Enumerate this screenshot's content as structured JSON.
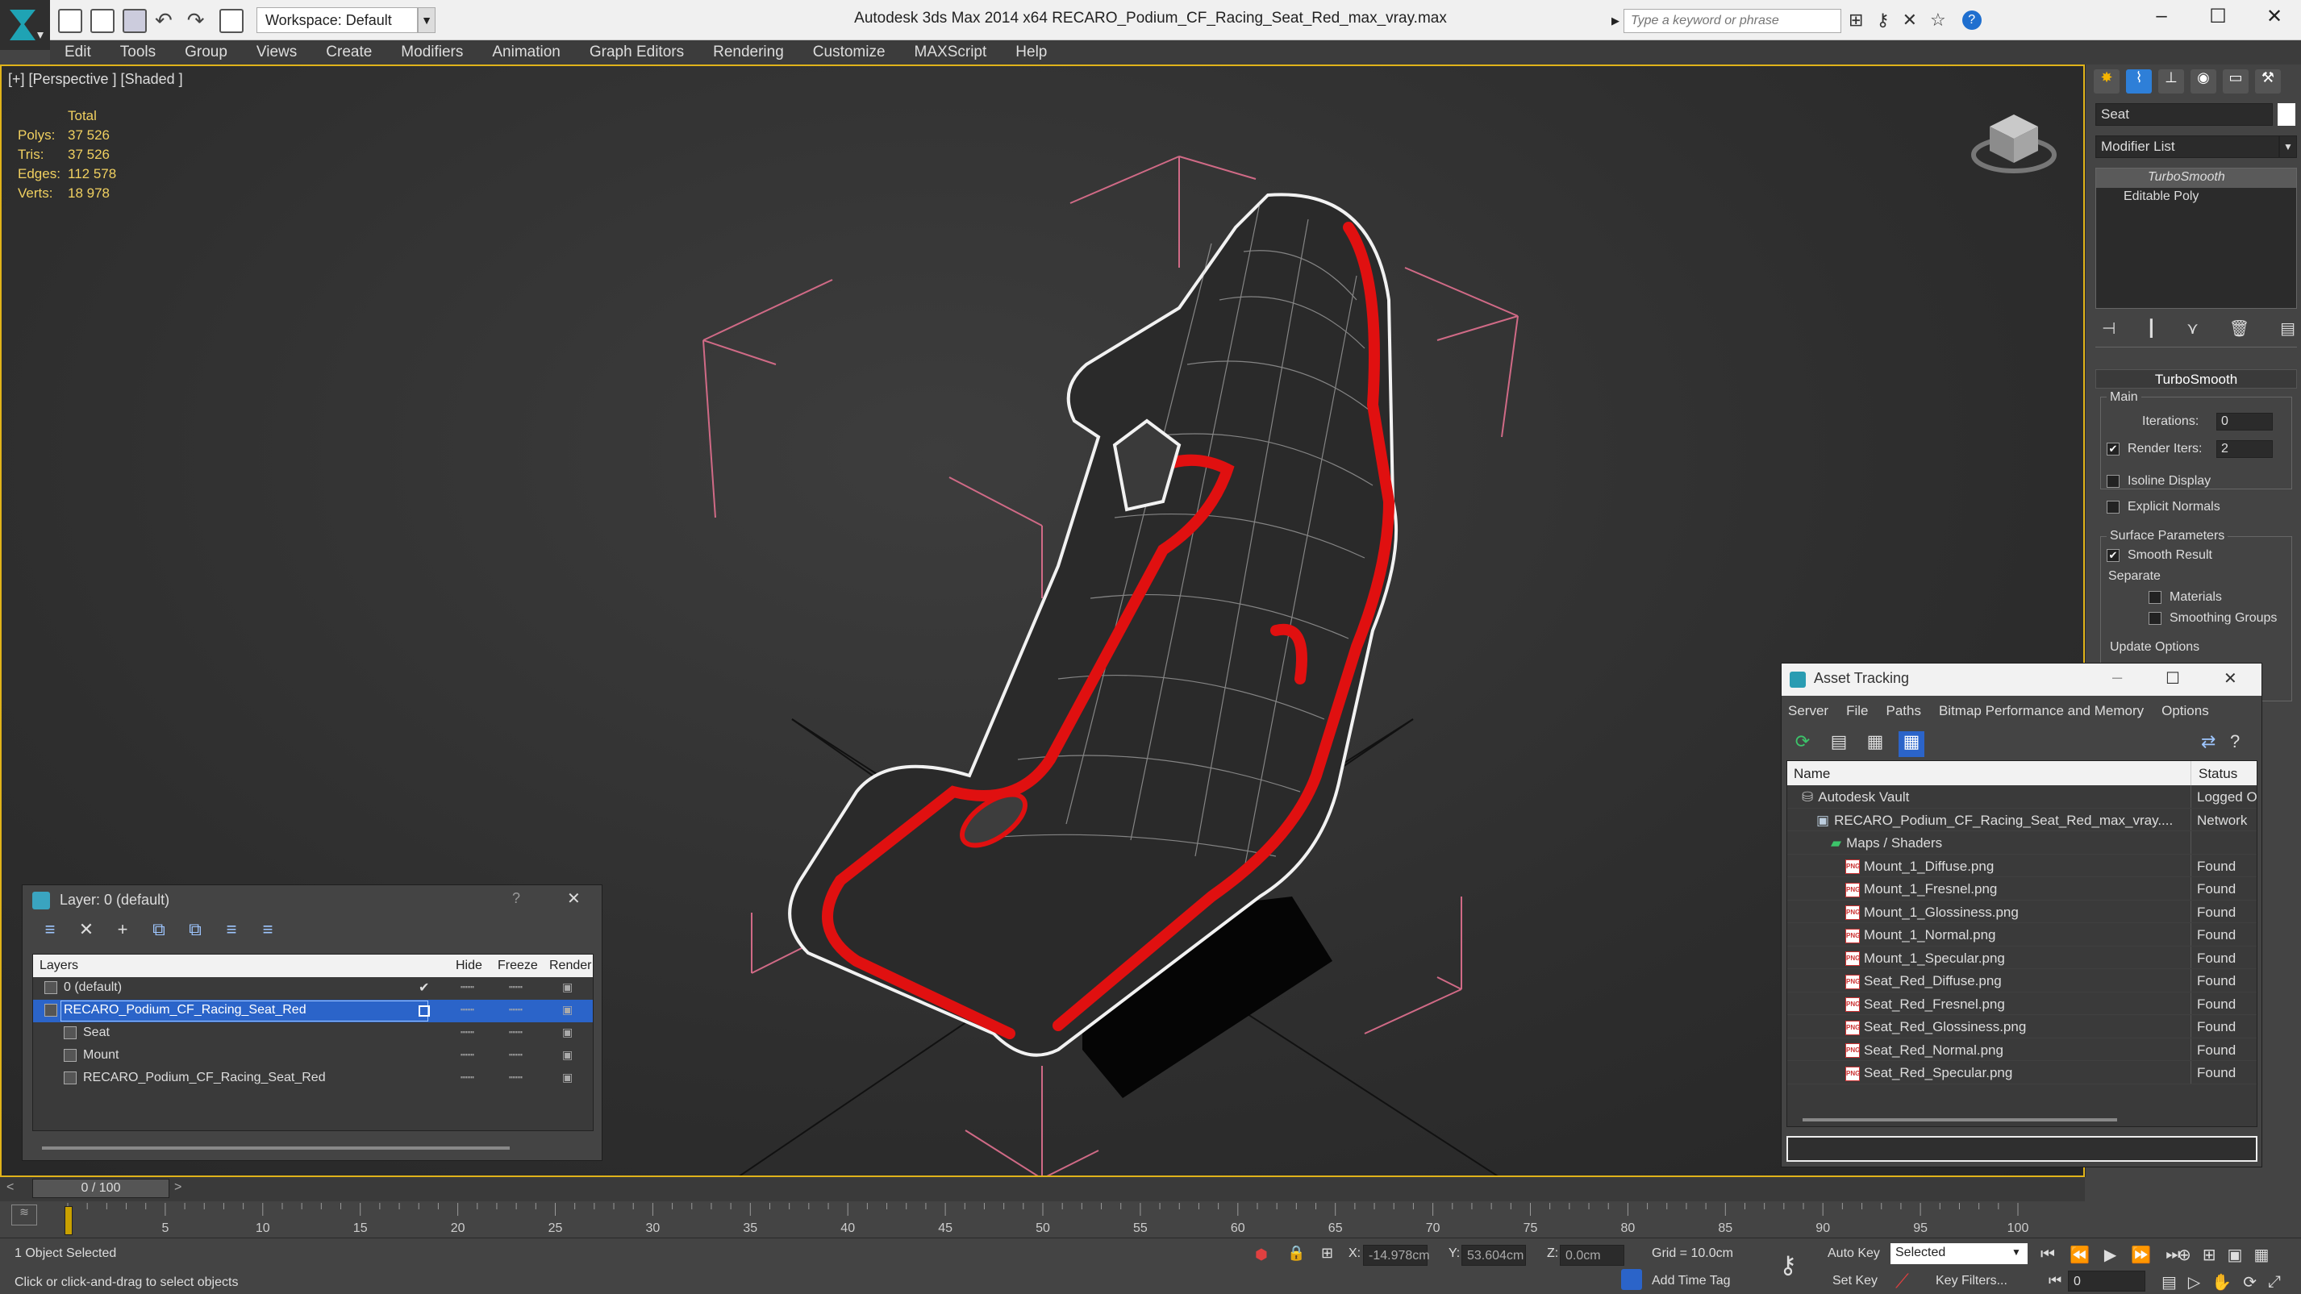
{
  "titlebar": {
    "title": "Autodesk 3ds Max  2014 x64     RECARO_Podium_CF_Racing_Seat_Red_max_vray.max",
    "workspace": "Workspace: Default",
    "search_placeholder": "Type a keyword or phrase"
  },
  "menu": [
    "Edit",
    "Tools",
    "Group",
    "Views",
    "Create",
    "Modifiers",
    "Animation",
    "Graph Editors",
    "Rendering",
    "Customize",
    "MAXScript",
    "Help"
  ],
  "viewport": {
    "label": "[+] [Perspective ] [Shaded ]",
    "stats_header": "Total",
    "stats": [
      {
        "k": "Polys:",
        "v": "37 526"
      },
      {
        "k": "Tris:",
        "v": "37 526"
      },
      {
        "k": "Edges:",
        "v": "112 578"
      },
      {
        "k": "Verts:",
        "v": "18 978"
      }
    ]
  },
  "command_panel": {
    "object_name": "Seat",
    "modifier_list": "Modifier List",
    "stack": [
      "TurboSmooth",
      "Editable Poly"
    ],
    "turbosmooth": {
      "title": "TurboSmooth",
      "main": "Main",
      "iterations_label": "Iterations:",
      "iterations": "0",
      "render_iters_label": "Render Iters:",
      "render_iters": "2",
      "isoline": "Isoline Display",
      "explicit": "Explicit Normals",
      "surface_params": "Surface Parameters",
      "smooth_result": "Smooth Result",
      "separate": "Separate",
      "materials": "Materials",
      "smoothing_groups": "Smoothing Groups",
      "update_options": "Update Options"
    }
  },
  "layer_dialog": {
    "title": "Layer: 0 (default)",
    "help": "?",
    "close": "✕",
    "columns": [
      "Layers",
      "Hide",
      "Freeze",
      "Render"
    ],
    "rows": [
      {
        "name": "0 (default)",
        "indent": 0,
        "selected": false,
        "check": "✔"
      },
      {
        "name": "RECARO_Podium_CF_Racing_Seat_Red",
        "indent": 0,
        "selected": true,
        "check": ""
      },
      {
        "name": "Seat",
        "indent": 1,
        "selected": false,
        "check": ""
      },
      {
        "name": "Mount",
        "indent": 1,
        "selected": false,
        "check": ""
      },
      {
        "name": "RECARO_Podium_CF_Racing_Seat_Red",
        "indent": 1,
        "selected": false,
        "check": ""
      }
    ]
  },
  "asset_tracking": {
    "title": "Asset Tracking",
    "menu": [
      "Server",
      "File",
      "Paths",
      "Bitmap Performance and Memory",
      "Options"
    ],
    "columns": [
      "Name",
      "Status"
    ],
    "rows": [
      {
        "name": "Autodesk Vault",
        "status": "Logged O",
        "indent": 1,
        "icon": "vault"
      },
      {
        "name": "RECARO_Podium_CF_Racing_Seat_Red_max_vray....",
        "status": "Network",
        "indent": 2,
        "icon": "max"
      },
      {
        "name": "Maps / Shaders",
        "status": "",
        "indent": 3,
        "icon": "folder"
      },
      {
        "name": "Mount_1_Diffuse.png",
        "status": "Found",
        "indent": 4,
        "icon": "png"
      },
      {
        "name": "Mount_1_Fresnel.png",
        "status": "Found",
        "indent": 4,
        "icon": "png"
      },
      {
        "name": "Mount_1_Glossiness.png",
        "status": "Found",
        "indent": 4,
        "icon": "png"
      },
      {
        "name": "Mount_1_Normal.png",
        "status": "Found",
        "indent": 4,
        "icon": "png"
      },
      {
        "name": "Mount_1_Specular.png",
        "status": "Found",
        "indent": 4,
        "icon": "png"
      },
      {
        "name": "Seat_Red_Diffuse.png",
        "status": "Found",
        "indent": 4,
        "icon": "png"
      },
      {
        "name": "Seat_Red_Fresnel.png",
        "status": "Found",
        "indent": 4,
        "icon": "png"
      },
      {
        "name": "Seat_Red_Glossiness.png",
        "status": "Found",
        "indent": 4,
        "icon": "png"
      },
      {
        "name": "Seat_Red_Normal.png",
        "status": "Found",
        "indent": 4,
        "icon": "png"
      },
      {
        "name": "Seat_Red_Specular.png",
        "status": "Found",
        "indent": 4,
        "icon": "png"
      }
    ]
  },
  "timeline": {
    "frame": "0 / 100",
    "ticks": [
      "0",
      "5",
      "10",
      "15",
      "20",
      "25",
      "30",
      "35",
      "40",
      "45",
      "50",
      "55",
      "60",
      "65",
      "70",
      "75",
      "80",
      "85",
      "90",
      "95",
      "100"
    ]
  },
  "status": {
    "selected": "1 Object Selected",
    "prompt": "Click or click-and-drag to select objects",
    "x_label": "X:",
    "x": "-14.978cm",
    "y_label": "Y:",
    "y": "53.604cm",
    "z_label": "Z:",
    "z": "0.0cm",
    "grid": "Grid = 10.0cm",
    "auto_key": "Auto Key",
    "auto_key_mode": "Selected",
    "set_key": "Set Key",
    "key_filters": "Key Filters...",
    "add_time_tag": "Add Time Tag",
    "frame_field": "0"
  },
  "colors": {
    "accent_selection": "#2b64c9",
    "viewport_border": "#e0b31a",
    "stats_text": "#f0d060",
    "seat_trim": "#e01010"
  }
}
